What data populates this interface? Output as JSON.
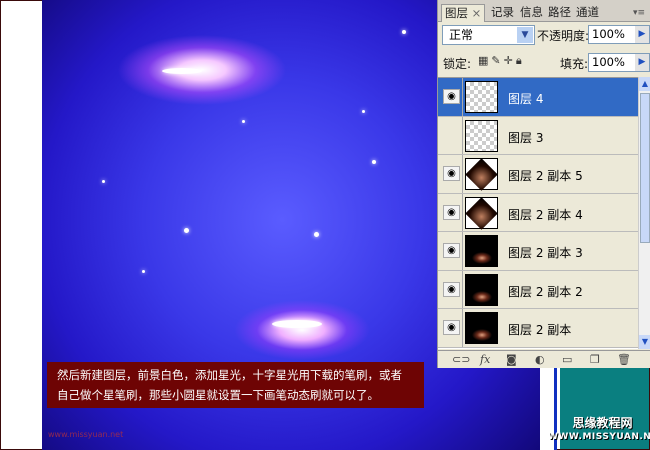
{
  "panel": {
    "tabs": [
      "图层",
      "记录",
      "信息",
      "路径",
      "通道"
    ],
    "tab_close": "×",
    "blend_mode": "正常",
    "opacity_label": "不透明度:",
    "opacity_value": "100%",
    "lock_label": "锁定:",
    "fill_label": "填充:",
    "fill_value": "100%",
    "layers": [
      {
        "name": "图层 4",
        "selected": true,
        "visible": true
      },
      {
        "name": "图层 3",
        "selected": false,
        "visible": false
      },
      {
        "name": "图层 2 副本 5",
        "selected": false,
        "visible": true
      },
      {
        "name": "图层 2 副本 4",
        "selected": false,
        "visible": true
      },
      {
        "name": "图层 2 副本 3",
        "selected": false,
        "visible": true
      },
      {
        "name": "图层 2 副本 2",
        "selected": false,
        "visible": true
      },
      {
        "name": "图层 2 副本",
        "selected": false,
        "visible": true
      }
    ],
    "fx_label": "fx"
  },
  "caption": {
    "line1": "然后新建图层，前景白色，添加星光，十字星光用下载的笔刷，或者",
    "line2": "自己做个星笔刷，那些小圆星就设置一下画笔动态刷就可以了。"
  },
  "watermark": {
    "site_name": "思缘教程网",
    "site_url": "WWW.MISSYUAN.NET",
    "small_url": "www.missyuan.net"
  }
}
